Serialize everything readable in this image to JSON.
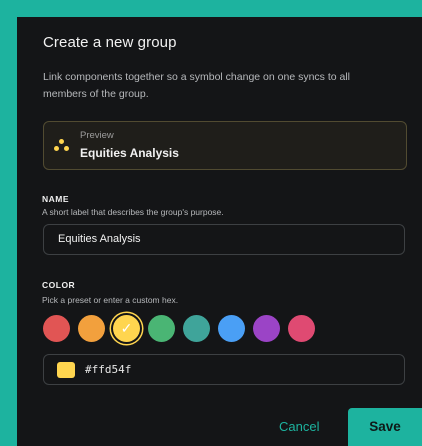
{
  "dialog": {
    "title": "Create a new group",
    "description": "Link components together so a symbol change on one syncs to all members of the group."
  },
  "preview": {
    "label": "Preview",
    "name": "Equities Analysis",
    "icon": "three-dots-cluster-icon"
  },
  "name_field": {
    "label": "NAME",
    "hint": "A short label that describes the group's purpose.",
    "value": "Equities Analysis"
  },
  "color_field": {
    "label": "COLOR",
    "hint": "Pick a preset or enter a custom hex.",
    "presets": [
      "#e15554",
      "#f2a03d",
      "#ffd54f",
      "#4ab574",
      "#3fa49a",
      "#4a9ff5",
      "#9b44c6",
      "#df4a72"
    ],
    "selected": "#ffd54f",
    "hex_value": "#ffd54f"
  },
  "actions": {
    "cancel_label": "Cancel",
    "save_label": "Save"
  },
  "colors": {
    "accent": "#1db39f",
    "background": "#141517"
  }
}
